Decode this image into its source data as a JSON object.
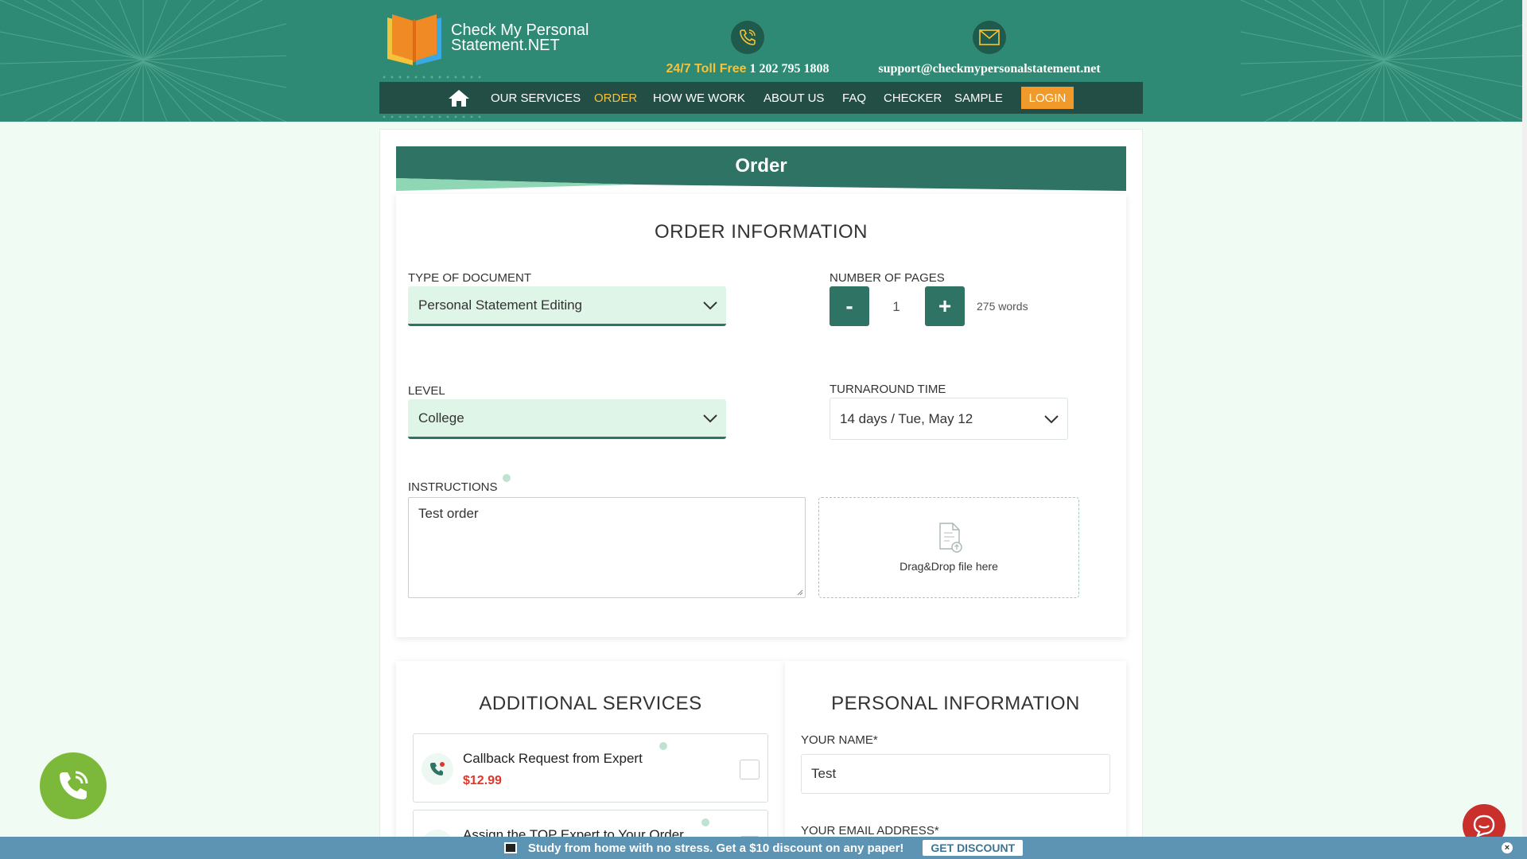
{
  "brand": {
    "logo_line1": "Check My Personal",
    "logo_line2": "Statement.NET"
  },
  "contact": {
    "phone_prefix": "24/7 Toll Free",
    "phone_number": "1 202 795 1808",
    "email": "support@checkmypersonalstatement.net"
  },
  "nav": {
    "items": [
      {
        "label": "OUR SERVICES"
      },
      {
        "label": "ORDER"
      },
      {
        "label": "HOW WE WORK"
      },
      {
        "label": "ABOUT US"
      },
      {
        "label": "FAQ"
      },
      {
        "label": "CHECKER"
      },
      {
        "label": "SAMPLE"
      }
    ],
    "login": "LOGIN"
  },
  "order": {
    "banner_title": "Order",
    "section_title": "ORDER INFORMATION",
    "type_of_document": {
      "label": "TYPE OF DOCUMENT",
      "value": "Personal Statement Editing"
    },
    "pages": {
      "label": "NUMBER OF PAGES",
      "minus": "-",
      "plus": "+",
      "value": "1",
      "words": "275 words"
    },
    "level": {
      "label": "LEVEL",
      "value": "College"
    },
    "turnaround": {
      "label": "TURNAROUND TIME",
      "value": "14 days / Tue, May 12"
    },
    "instructions": {
      "label": "INSTRUCTIONS",
      "value": "Test order"
    },
    "dropzone": {
      "text": "Drag&Drop file here"
    }
  },
  "additional": {
    "title": "ADDITIONAL SERVICES",
    "items": [
      {
        "title": "Callback Request from Expert",
        "price": "$12.99"
      },
      {
        "title": "Assign the TOP Expert to Your Order",
        "price": ""
      }
    ]
  },
  "personal": {
    "title": "PERSONAL INFORMATION",
    "name_label": "YOUR NAME*",
    "name_value": "Test",
    "email_label": "YOUR EMAIL ADDRESS*"
  },
  "promo": {
    "text": "Study from home with no stress. Get a $10 discount on any paper!",
    "button": "GET DISCOUNT",
    "close": "×"
  },
  "colors": {
    "header_bg": "#2e8a74",
    "nav_bg": "#234e46",
    "accent_yellow": "#f5c33b",
    "login_orange": "#f09a2c",
    "button_teal": "#2e7363",
    "price_red": "#e0372c",
    "promo_bar": "#5d93b3"
  }
}
